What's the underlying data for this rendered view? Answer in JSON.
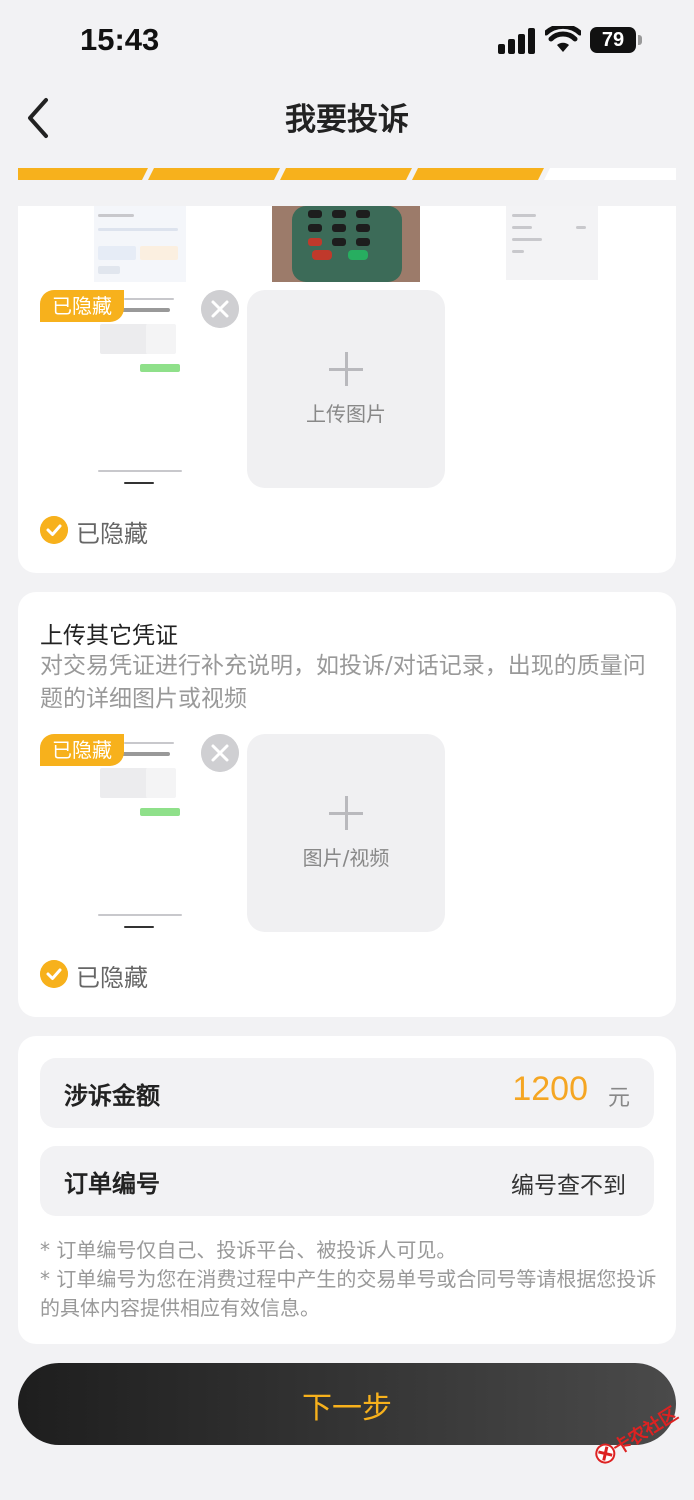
{
  "status": {
    "time": "15:43",
    "battery": "79"
  },
  "nav": {
    "title": "我要投诉"
  },
  "colors": {
    "accent": "#f7b11c",
    "amount": "#f5a623",
    "button_bg": "#2a2a2a"
  },
  "card1": {
    "hidden_tag": "已隐藏",
    "upload_label": "上传图片",
    "check_label": "已隐藏"
  },
  "card2": {
    "title": "上传其它凭证",
    "desc": "对交易凭证进行补充说明，如投诉/对话记录，出现的质量问题的详细图片或视频",
    "hidden_tag": "已隐藏",
    "upload_label": "图片/视频",
    "check_label": "已隐藏"
  },
  "card3": {
    "amount_label": "涉诉金额",
    "amount_value": "1200",
    "amount_unit": "元",
    "order_label": "订单编号",
    "order_value": "编号查不到",
    "note1": "* 订单编号仅自己、投诉平台、被投诉人可见。",
    "note2": "* 订单编号为您在消费过程中产生的交易单号或合同号等请根据您投诉的具体内容提供相应有效信息。"
  },
  "next_button": {
    "label": "下一步"
  },
  "watermark": {
    "text": "卡农社区"
  }
}
